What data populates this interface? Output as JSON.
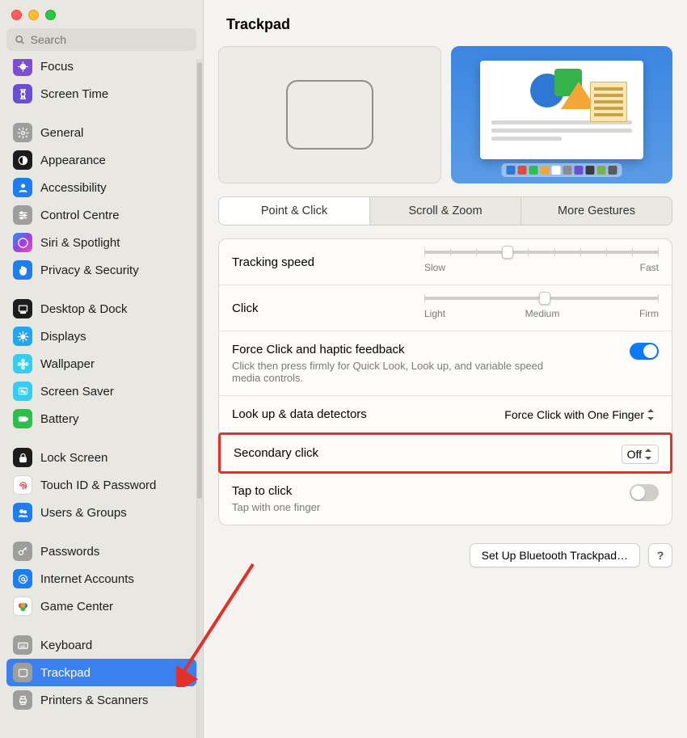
{
  "window": {
    "title": "Trackpad"
  },
  "search": {
    "placeholder": "Search"
  },
  "sidebar": {
    "items": [
      {
        "label": "Focus",
        "icon": "focus",
        "bg": "#7f4dd1"
      },
      {
        "label": "Screen Time",
        "icon": "hourglass",
        "bg": "#6a4ed6"
      },
      {
        "gap": true
      },
      {
        "label": "General",
        "icon": "gear",
        "bg": "#9e9e9d"
      },
      {
        "label": "Appearance",
        "icon": "appearance",
        "bg": "#1c1c1c"
      },
      {
        "label": "Accessibility",
        "icon": "person",
        "bg": "#1e7ef0"
      },
      {
        "label": "Control Centre",
        "icon": "sliders",
        "bg": "#9e9e9d"
      },
      {
        "label": "Siri & Spotlight",
        "icon": "siri",
        "bg": "grad"
      },
      {
        "label": "Privacy & Security",
        "icon": "hand",
        "bg": "#1e7ef0"
      },
      {
        "gap": true
      },
      {
        "label": "Desktop & Dock",
        "icon": "dock",
        "bg": "#1c1c1c"
      },
      {
        "label": "Displays",
        "icon": "sun",
        "bg": "#1ea8f0"
      },
      {
        "label": "Wallpaper",
        "icon": "flower",
        "bg": "#37cdef"
      },
      {
        "label": "Screen Saver",
        "icon": "screensaver",
        "bg": "#37cdef"
      },
      {
        "label": "Battery",
        "icon": "battery",
        "bg": "#2fbe4c"
      },
      {
        "gap": true
      },
      {
        "label": "Lock Screen",
        "icon": "lock",
        "bg": "#1c1c1c"
      },
      {
        "label": "Touch ID & Password",
        "icon": "fingerprint",
        "bg": "#ffffff",
        "fg": "#e14e62"
      },
      {
        "label": "Users & Groups",
        "icon": "users",
        "bg": "#1e7ef0"
      },
      {
        "gap": true
      },
      {
        "label": "Passwords",
        "icon": "key",
        "bg": "#9e9e9d"
      },
      {
        "label": "Internet Accounts",
        "icon": "at",
        "bg": "#1e7ef0"
      },
      {
        "label": "Game Center",
        "icon": "gamecenter",
        "bg": "#ffffff"
      },
      {
        "gap": true
      },
      {
        "label": "Keyboard",
        "icon": "keyboard",
        "bg": "#9e9e9d"
      },
      {
        "label": "Trackpad",
        "icon": "trackpad",
        "bg": "#9e9e9d",
        "selected": true
      },
      {
        "label": "Printers & Scanners",
        "icon": "printer",
        "bg": "#9e9e9d"
      }
    ]
  },
  "tabs": {
    "items": [
      "Point & Click",
      "Scroll & Zoom",
      "More Gestures"
    ],
    "active": 0
  },
  "settings": {
    "tracking": {
      "label": "Tracking speed",
      "min": "Slow",
      "max": "Fast",
      "ticks": 10,
      "value": 3
    },
    "click": {
      "label": "Click",
      "labels": [
        "Light",
        "Medium",
        "Firm"
      ],
      "ticks": 3,
      "value": 1
    },
    "force": {
      "label": "Force Click and haptic feedback",
      "sub": "Click then press firmly for Quick Look, Look up, and variable speed media controls.",
      "on": true
    },
    "lookup": {
      "label": "Look up & data detectors",
      "value": "Force Click with One Finger"
    },
    "secondary": {
      "label": "Secondary click",
      "value": "Off"
    },
    "tap": {
      "label": "Tap to click",
      "sub": "Tap with one finger",
      "on": false
    }
  },
  "footer": {
    "setup": "Set Up Bluetooth Trackpad…",
    "help": "?"
  },
  "dock_colors": [
    "#2e77d4",
    "#e24b3b",
    "#2fbe4c",
    "#f3a535",
    "#ffffff",
    "#8b8b8b",
    "#6e4fd1",
    "#3c3c3c",
    "#7bb04a",
    "#5b5b5b"
  ]
}
